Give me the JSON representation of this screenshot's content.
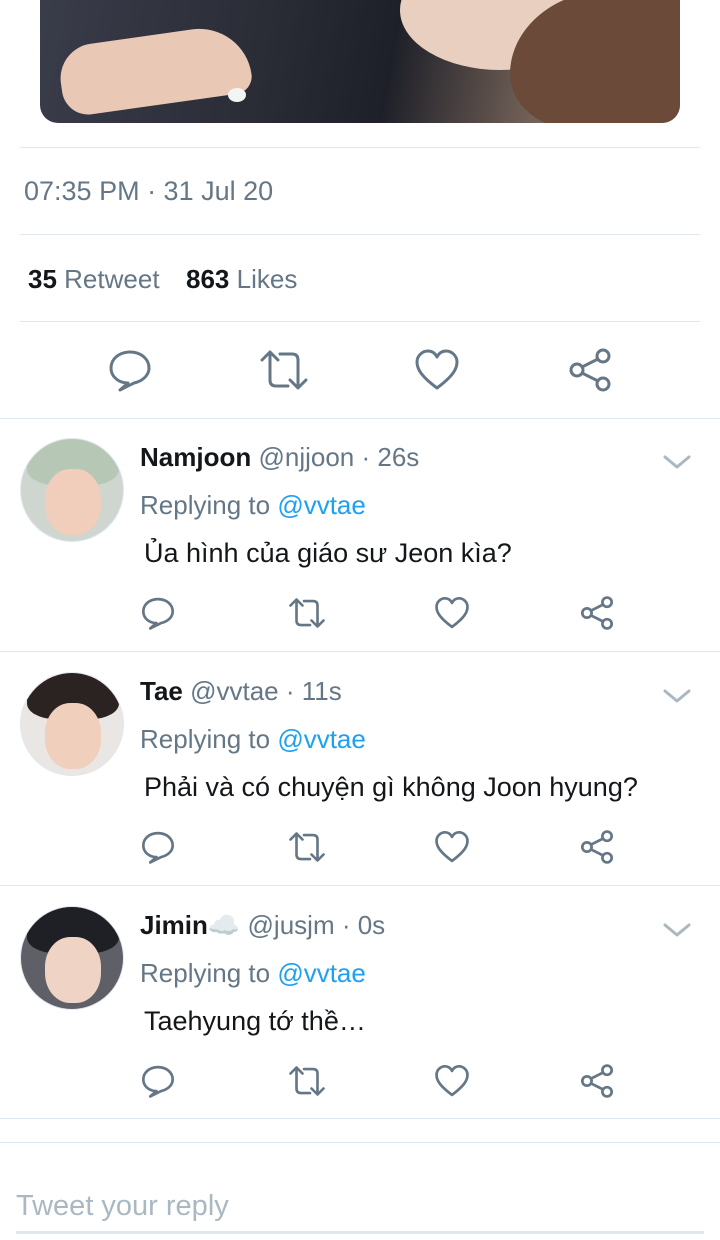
{
  "tweet": {
    "timestamp": "07:35 PM · 31 Jul 20",
    "retweet_count": "35",
    "retweet_label": "Retweet",
    "likes_count": "863",
    "likes_label": "Likes",
    "actions": [
      "reply-icon",
      "retweet-icon",
      "like-icon",
      "share-icon"
    ]
  },
  "replies": [
    {
      "name": "Namjoon",
      "handle": "@njjoon · 26s",
      "replying_prefix": "Replying to ",
      "replying_to": "@vvtae",
      "text": "Ủa hình của giáo sư Jeon kìa?"
    },
    {
      "name": "Tae",
      "handle": "@vvtae · 11s",
      "replying_prefix": "Replying to ",
      "replying_to": "@vvtae",
      "text": "Phải và có chuyện gì không Joon hyung?"
    },
    {
      "name": "Jimin",
      "name_emoji": "☁️",
      "handle": "@jusjm · 0s",
      "replying_prefix": "Replying to ",
      "replying_to": "@vvtae",
      "text": "Taehyung tớ thề…"
    }
  ],
  "compose": {
    "placeholder": "Tweet your reply"
  },
  "colors": {
    "accent": "#1da1f2",
    "icon": "#657786",
    "divider": "#e1e8ed"
  }
}
